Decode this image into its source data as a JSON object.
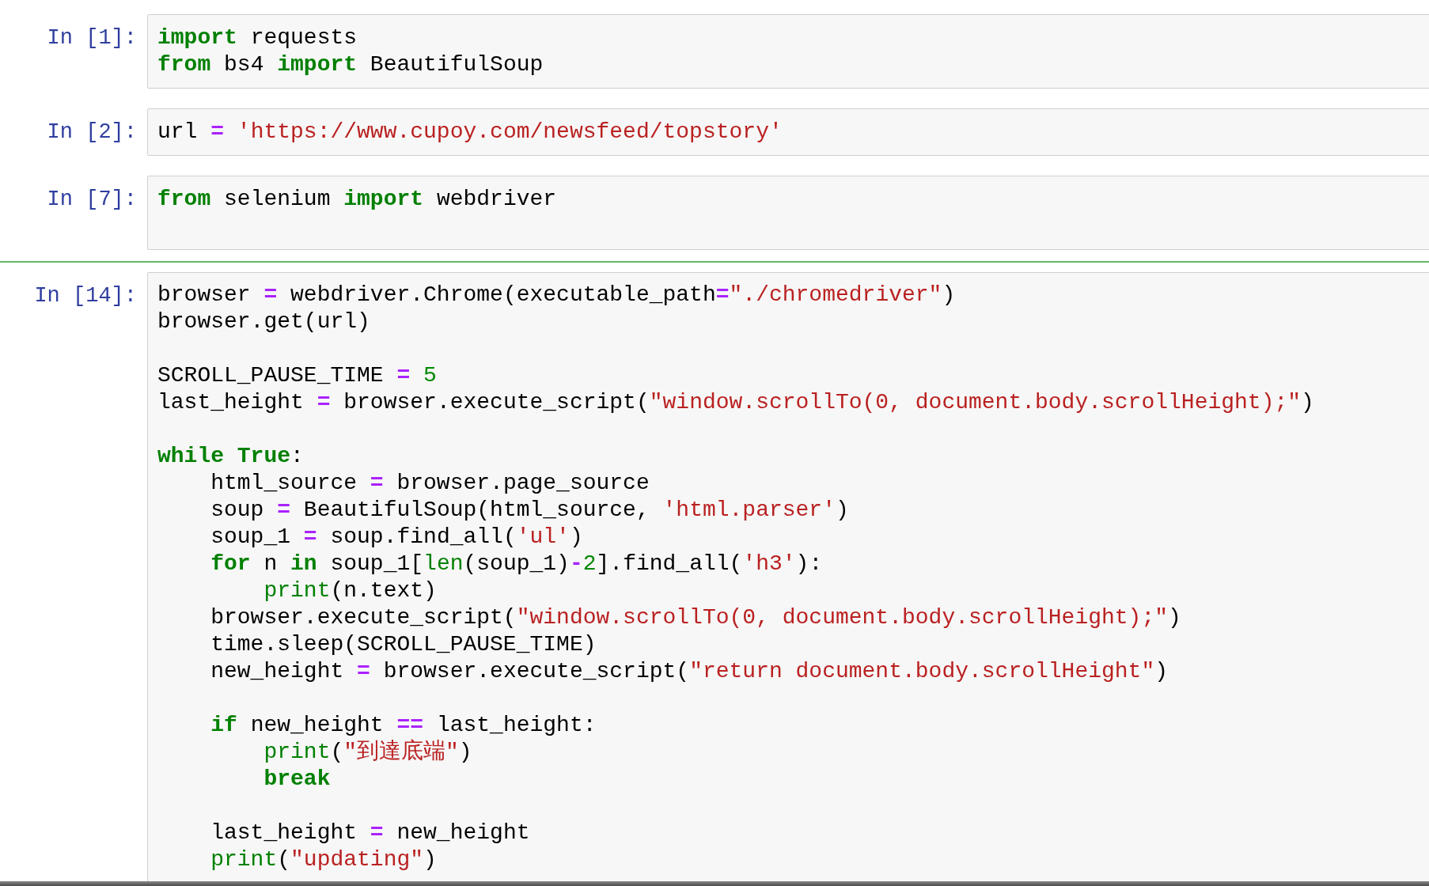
{
  "cells": [
    {
      "prompt": "In [1]:",
      "selected": false,
      "lines": [
        {
          "kind": "code",
          "tokens": [
            {
              "kind": "keyword",
              "text": "import"
            },
            {
              "kind": "text",
              "text": " requests"
            }
          ]
        },
        {
          "kind": "code",
          "tokens": [
            {
              "kind": "keyword",
              "text": "from"
            },
            {
              "kind": "text",
              "text": " bs4 "
            },
            {
              "kind": "keyword",
              "text": "import"
            },
            {
              "kind": "text",
              "text": " BeautifulSoup"
            }
          ]
        }
      ]
    },
    {
      "prompt": "In [2]:",
      "selected": false,
      "lines": [
        {
          "kind": "code",
          "tokens": [
            {
              "kind": "text",
              "text": "url "
            },
            {
              "kind": "operator",
              "text": "= "
            },
            {
              "kind": "string",
              "text": "'https://www.cupoy.com/newsfeed/topstory'"
            }
          ]
        }
      ]
    },
    {
      "prompt": "In [7]:",
      "selected": false,
      "lines": [
        {
          "kind": "code",
          "tokens": [
            {
              "kind": "keyword",
              "text": "from"
            },
            {
              "kind": "text",
              "text": " selenium "
            },
            {
              "kind": "keyword",
              "text": "import"
            },
            {
              "kind": "text",
              "text": " webdriver"
            }
          ]
        },
        {
          "kind": "blank"
        }
      ]
    },
    {
      "prompt": "In [14]:",
      "selected": true,
      "lines": [
        {
          "kind": "code",
          "tokens": [
            {
              "kind": "text",
              "text": "browser "
            },
            {
              "kind": "operator",
              "text": "="
            },
            {
              "kind": "text",
              "text": " webdriver.Chrome(executable_path"
            },
            {
              "kind": "operator",
              "text": "="
            },
            {
              "kind": "string",
              "text": "\"./chromedriver\""
            },
            {
              "kind": "text",
              "text": ")"
            }
          ]
        },
        {
          "kind": "code",
          "tokens": [
            {
              "kind": "text",
              "text": "browser.get(url)"
            }
          ]
        },
        {
          "kind": "blank"
        },
        {
          "kind": "code",
          "tokens": [
            {
              "kind": "text",
              "text": "SCROLL_PAUSE_TIME "
            },
            {
              "kind": "operator",
              "text": "= "
            },
            {
              "kind": "number",
              "text": "5"
            }
          ]
        },
        {
          "kind": "code",
          "tokens": [
            {
              "kind": "text",
              "text": "last_height "
            },
            {
              "kind": "operator",
              "text": "="
            },
            {
              "kind": "text",
              "text": " browser.execute_script("
            },
            {
              "kind": "string",
              "text": "\"window.scrollTo(0, document.body.scrollHeight);\""
            },
            {
              "kind": "text",
              "text": ")"
            }
          ]
        },
        {
          "kind": "blank"
        },
        {
          "kind": "code",
          "tokens": [
            {
              "kind": "keyword",
              "text": "while True"
            },
            {
              "kind": "text",
              "text": ":"
            }
          ]
        },
        {
          "kind": "code",
          "tokens": [
            {
              "kind": "text",
              "text": "    html_source "
            },
            {
              "kind": "operator",
              "text": "="
            },
            {
              "kind": "text",
              "text": " browser.page_source"
            }
          ]
        },
        {
          "kind": "code",
          "tokens": [
            {
              "kind": "text",
              "text": "    soup "
            },
            {
              "kind": "operator",
              "text": "="
            },
            {
              "kind": "text",
              "text": " BeautifulSoup(html_source, "
            },
            {
              "kind": "string",
              "text": "'html.parser'"
            },
            {
              "kind": "text",
              "text": ")"
            }
          ]
        },
        {
          "kind": "code",
          "tokens": [
            {
              "kind": "text",
              "text": "    soup_1 "
            },
            {
              "kind": "operator",
              "text": "="
            },
            {
              "kind": "text",
              "text": " soup.find_all("
            },
            {
              "kind": "string",
              "text": "'ul'"
            },
            {
              "kind": "text",
              "text": ")"
            }
          ]
        },
        {
          "kind": "code",
          "tokens": [
            {
              "kind": "keyword",
              "text": "    for"
            },
            {
              "kind": "text",
              "text": " n "
            },
            {
              "kind": "keyword",
              "text": "in"
            },
            {
              "kind": "text",
              "text": " soup_1["
            },
            {
              "kind": "builtin",
              "text": "len"
            },
            {
              "kind": "text",
              "text": "(soup_1)"
            },
            {
              "kind": "operator",
              "text": "-"
            },
            {
              "kind": "number",
              "text": "2"
            },
            {
              "kind": "text",
              "text": "].find_all("
            },
            {
              "kind": "string",
              "text": "'h3'"
            },
            {
              "kind": "text",
              "text": "):"
            }
          ]
        },
        {
          "kind": "code",
          "tokens": [
            {
              "kind": "builtin",
              "text": "        print"
            },
            {
              "kind": "text",
              "text": "(n.text)"
            }
          ]
        },
        {
          "kind": "code",
          "tokens": [
            {
              "kind": "text",
              "text": "    browser.execute_script("
            },
            {
              "kind": "string",
              "text": "\"window.scrollTo(0, document.body.scrollHeight);\""
            },
            {
              "kind": "text",
              "text": ")"
            }
          ]
        },
        {
          "kind": "code",
          "tokens": [
            {
              "kind": "text",
              "text": "    time.sleep(SCROLL_PAUSE_TIME)"
            }
          ]
        },
        {
          "kind": "code",
          "tokens": [
            {
              "kind": "text",
              "text": "    new_height "
            },
            {
              "kind": "operator",
              "text": "="
            },
            {
              "kind": "text",
              "text": " browser.execute_script("
            },
            {
              "kind": "string",
              "text": "\"return document.body.scrollHeight\""
            },
            {
              "kind": "text",
              "text": ")"
            }
          ]
        },
        {
          "kind": "blank"
        },
        {
          "kind": "code",
          "tokens": [
            {
              "kind": "keyword",
              "text": "    if"
            },
            {
              "kind": "text",
              "text": " new_height "
            },
            {
              "kind": "operator",
              "text": "=="
            },
            {
              "kind": "text",
              "text": " last_height:"
            }
          ]
        },
        {
          "kind": "code",
          "tokens": [
            {
              "kind": "builtin",
              "text": "        print"
            },
            {
              "kind": "text",
              "text": "("
            },
            {
              "kind": "string",
              "text": "\"到達底端\""
            },
            {
              "kind": "text",
              "text": ")"
            }
          ]
        },
        {
          "kind": "code",
          "tokens": [
            {
              "kind": "keyword",
              "text": "        break"
            }
          ]
        },
        {
          "kind": "blank"
        },
        {
          "kind": "code",
          "tokens": [
            {
              "kind": "text",
              "text": "    last_height "
            },
            {
              "kind": "operator",
              "text": "="
            },
            {
              "kind": "text",
              "text": " new_height"
            }
          ]
        },
        {
          "kind": "code",
          "tokens": [
            {
              "kind": "builtin",
              "text": "    print"
            },
            {
              "kind": "text",
              "text": "("
            },
            {
              "kind": "string",
              "text": "\"updating\""
            },
            {
              "kind": "text",
              "text": ")"
            }
          ]
        }
      ]
    }
  ]
}
